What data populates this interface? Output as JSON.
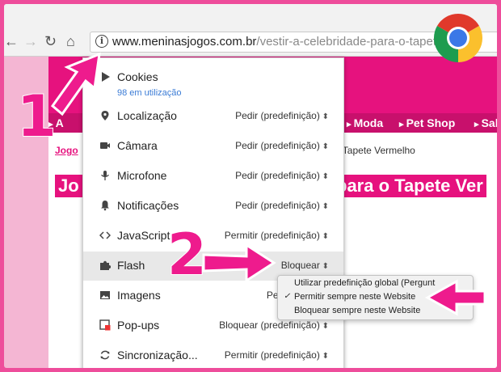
{
  "browser": {
    "url_domain": "www.meninasjogos.com.br",
    "url_path": "/vestir-a-celebridade-para-o-tapete"
  },
  "page": {
    "menu": [
      "A",
      "Moda",
      "Pet Shop",
      "Sal"
    ],
    "crumb_link": "Jogo",
    "crumb_text": "a o Tapete Vermelho",
    "title_left": "Jo",
    "title_right": "para o Tapete Ver"
  },
  "site_info": {
    "cookies": {
      "label": "Cookies",
      "sub": "98 em utilização"
    },
    "permissions": [
      {
        "label": "Localização",
        "value": "Pedir (predefinição)",
        "icon": "location-icon"
      },
      {
        "label": "Câmara",
        "value": "Pedir (predefinição)",
        "icon": "camera-icon"
      },
      {
        "label": "Microfone",
        "value": "Pedir (predefinição)",
        "icon": "microphone-icon"
      },
      {
        "label": "Notificações",
        "value": "Pedir (predefinição)",
        "icon": "bell-icon"
      },
      {
        "label": "JavaScript",
        "value": "Permitir (predefinição)",
        "icon": "code-icon"
      },
      {
        "label": "Flash",
        "value": "Bloquear",
        "icon": "puzzle-icon"
      },
      {
        "label": "Imagens",
        "value": "Permitir (pre",
        "icon": "image-icon"
      },
      {
        "label": "Pop-ups",
        "value": "Bloquear (predefinição)",
        "icon": "popup-blocked-icon"
      },
      {
        "label": "Sincronização...",
        "value": "Permitir (predefinição)",
        "icon": "sync-icon"
      }
    ]
  },
  "flash_dropdown": {
    "options": [
      "Utilizar predefinição global (Pergunt",
      "Permitir sempre neste Website",
      "Bloquear sempre neste Website"
    ],
    "checked_index": 1
  },
  "annotations": {
    "step1": "1",
    "step2": "2"
  },
  "colors": {
    "accent": "#ee1b8d",
    "site_pink": "#e6127e"
  }
}
